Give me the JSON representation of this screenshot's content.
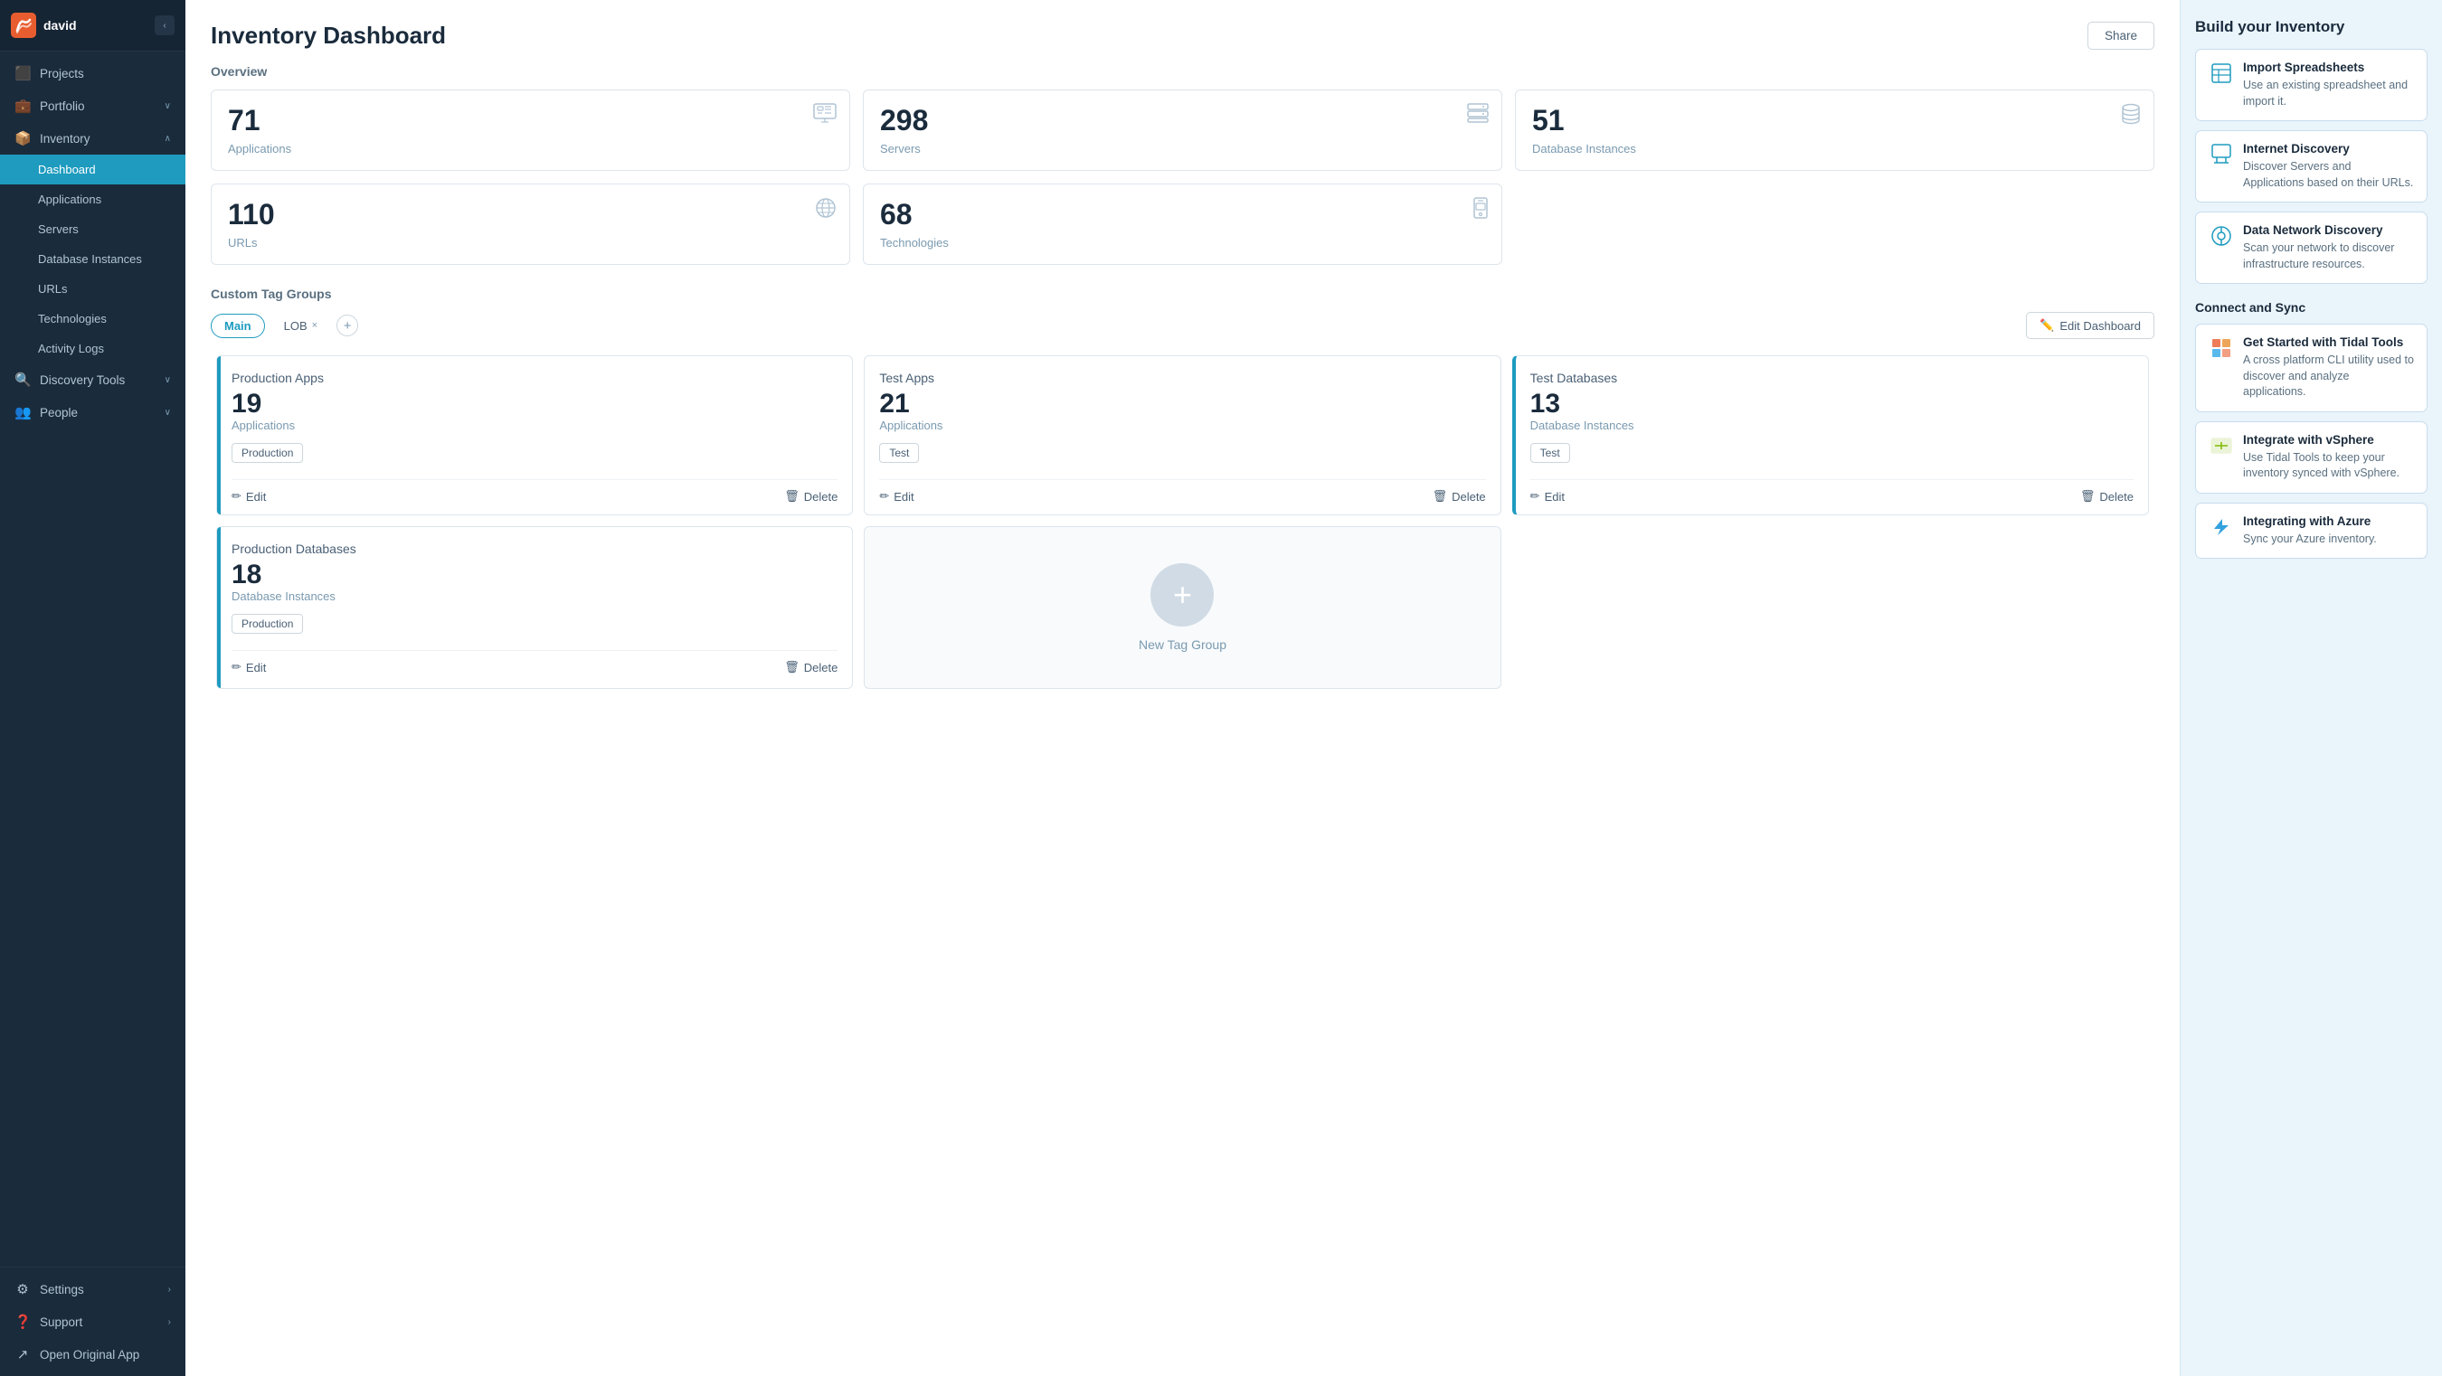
{
  "sidebar": {
    "username": "david",
    "nav": {
      "projects": "Projects",
      "portfolio": "Portfolio",
      "inventory": "Inventory",
      "inventory_sub": {
        "dashboard": "Dashboard",
        "applications": "Applications",
        "servers": "Servers",
        "database_instances": "Database Instances",
        "urls": "URLs",
        "technologies": "Technologies",
        "activity_logs": "Activity Logs"
      },
      "discovery_tools": "Discovery Tools",
      "people": "People",
      "settings": "Settings",
      "support": "Support",
      "open_original_app": "Open Original App"
    }
  },
  "header": {
    "title": "Inventory Dashboard",
    "share_label": "Share"
  },
  "overview": {
    "section_label": "Overview",
    "stats": [
      {
        "number": "71",
        "label": "Applications",
        "icon": "monitor"
      },
      {
        "number": "298",
        "label": "Servers",
        "icon": "server"
      },
      {
        "number": "51",
        "label": "Database Instances",
        "icon": "database"
      },
      {
        "number": "110",
        "label": "URLs",
        "icon": "globe"
      },
      {
        "number": "68",
        "label": "Technologies",
        "icon": "mobile"
      }
    ]
  },
  "tag_groups": {
    "section_label": "Custom Tag Groups",
    "tabs": [
      {
        "label": "Main",
        "active": true,
        "closeable": false
      },
      {
        "label": "LOB",
        "active": false,
        "closeable": true
      }
    ],
    "edit_dashboard_label": "Edit Dashboard",
    "cards": [
      {
        "title": "Production Apps",
        "number": "19",
        "subtitle": "Applications",
        "pill": "Production",
        "has_accent": true
      },
      {
        "title": "Test Apps",
        "number": "21",
        "subtitle": "Applications",
        "pill": "Test",
        "has_accent": false
      },
      {
        "title": "Test Databases",
        "number": "13",
        "subtitle": "Database Instances",
        "pill": "Test",
        "has_accent": true
      },
      {
        "title": "Production Databases",
        "number": "18",
        "subtitle": "Database Instances",
        "pill": "Production",
        "has_accent": true
      }
    ],
    "edit_label": "Edit",
    "delete_label": "Delete",
    "new_tag_group_label": "New Tag Group"
  },
  "right_panel": {
    "build_title": "Build your Inventory",
    "build_items": [
      {
        "title": "Import Spreadsheets",
        "desc": "Use an existing spreadsheet and import it.",
        "icon": "📊"
      },
      {
        "title": "Internet Discovery",
        "desc": "Discover Servers and Applications based on their URLs.",
        "icon": "🌐"
      },
      {
        "title": "Data Network Discovery",
        "desc": "Scan your network to discover infrastructure resources.",
        "icon": "🎯"
      }
    ],
    "connect_title": "Connect and Sync",
    "connect_items": [
      {
        "title": "Get Started with Tidal Tools",
        "desc": "A cross platform CLI utility used to discover and analyze applications.",
        "icon": "📦"
      },
      {
        "title": "Integrate with vSphere",
        "desc": "Use Tidal Tools to keep your inventory synced with vSphere.",
        "icon": "🔧"
      },
      {
        "title": "Integrating with Azure",
        "desc": "Sync your Azure inventory.",
        "icon": "☁️"
      }
    ]
  }
}
